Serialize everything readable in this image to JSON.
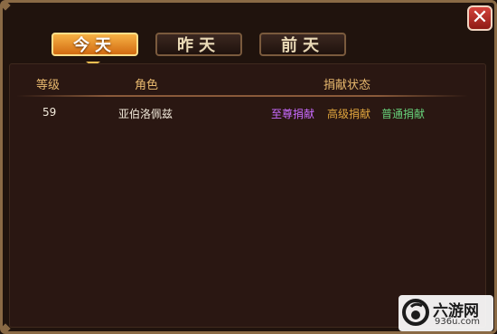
{
  "tabs": [
    {
      "label": "今天",
      "active": true
    },
    {
      "label": "昨天",
      "active": false
    },
    {
      "label": "前天",
      "active": false
    }
  ],
  "close_icon": "close-icon",
  "table": {
    "headers": {
      "level": "等级",
      "role": "角色",
      "status": "捐献状态"
    },
    "rows": [
      {
        "level": "59",
        "role": "亚伯洛佩兹",
        "donations": [
          {
            "label": "至尊捐献",
            "color": "#c96bff"
          },
          {
            "label": "高级捐献",
            "color": "#e0a53d"
          },
          {
            "label": "普通捐献",
            "color": "#67d27a"
          }
        ]
      }
    ]
  },
  "watermark": {
    "name": "六游网",
    "url": "936u.com"
  },
  "colors": {
    "accent": "#f7b245",
    "frame": "#8a6a45",
    "header_text": "#e8b96e"
  }
}
